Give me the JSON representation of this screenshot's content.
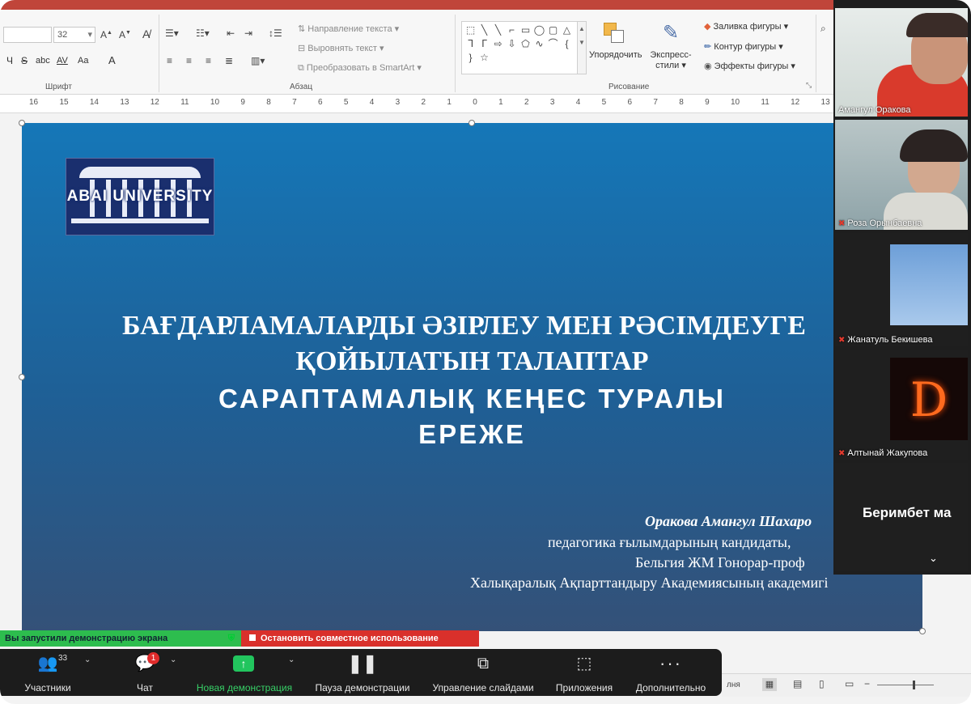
{
  "ribbon": {
    "font_size": "32",
    "font_row2": [
      "Ч",
      "S",
      "abc",
      "AV",
      "Aa",
      "A"
    ],
    "paragraph": {
      "text_direction": "Направление текста",
      "align_text": "Выровнять текст",
      "convert_smartart": "Преобразовать в SmartArt"
    },
    "drawing": {
      "arrange": "Упорядочить",
      "quick_styles_line1": "Экспресс-",
      "quick_styles_line2": "стили",
      "shape_fill": "Заливка фигуры",
      "shape_outline": "Контур фигуры",
      "shape_effects": "Эффекты фигуры"
    },
    "group_labels": {
      "font": "Шрифт",
      "paragraph": "Абзац",
      "drawing": "Рисование"
    }
  },
  "ruler": {
    "ticks": [
      "16",
      "15",
      "14",
      "13",
      "12",
      "11",
      "10",
      "9",
      "8",
      "7",
      "6",
      "5",
      "4",
      "3",
      "2",
      "1",
      "0",
      "1",
      "2",
      "3",
      "4",
      "5",
      "6",
      "7",
      "8",
      "9",
      "10",
      "11",
      "12",
      "13"
    ]
  },
  "slide": {
    "logo_text": "ABAI UNIVERSITY",
    "title_line1": "БАҒДАРЛАМАЛАРДЫ ӘЗІРЛЕУ МЕН РӘСІМДЕУГЕ",
    "title_line2": "ҚОЙЫЛАТЫН ТАЛАПТАР",
    "title_line3": "САРАПТАМАЛЫҚ КЕҢЕС ТУРАЛЫ",
    "title_line4": "ЕРЕЖЕ",
    "author_name": "Оракова Амангул Шахаро",
    "author_line2": "педагогика ғылымдарының кандидаты,",
    "author_line3": "Бельгия ЖМ Гонорар-проф",
    "author_line4": "Халықаралық Ақпарттандыру Академиясының академигі"
  },
  "participants": [
    {
      "name": "Амангул Оракова"
    },
    {
      "name": "Роза Орынбаевна"
    },
    {
      "name": "Жанатуль Бекишева"
    },
    {
      "name": "Алтынай Жакупова"
    },
    {
      "name": "Беримбет ма"
    }
  ],
  "banners": {
    "sharing": "Вы запустили демонстрацию экрана",
    "stop_sharing": "Остановить совместное использование"
  },
  "toolbar": {
    "participants_count": "33",
    "participants": "Участники",
    "chat_badge": "1",
    "chat": "Чат",
    "new_share": "Новая демонстрация",
    "pause_share": "Пауза демонстрации",
    "manage_slides": "Управление слайдами",
    "apps": "Приложения",
    "more": "Дополнительно"
  },
  "status_bar": {
    "label": "лня"
  },
  "colors": {
    "slide_top": "#1577b8",
    "slide_bottom": "#345178",
    "banner_green": "#2dbd4e",
    "banner_red": "#d9302b",
    "toolbar_bg": "#1c1c1c",
    "new_share_green": "#22c55e"
  }
}
